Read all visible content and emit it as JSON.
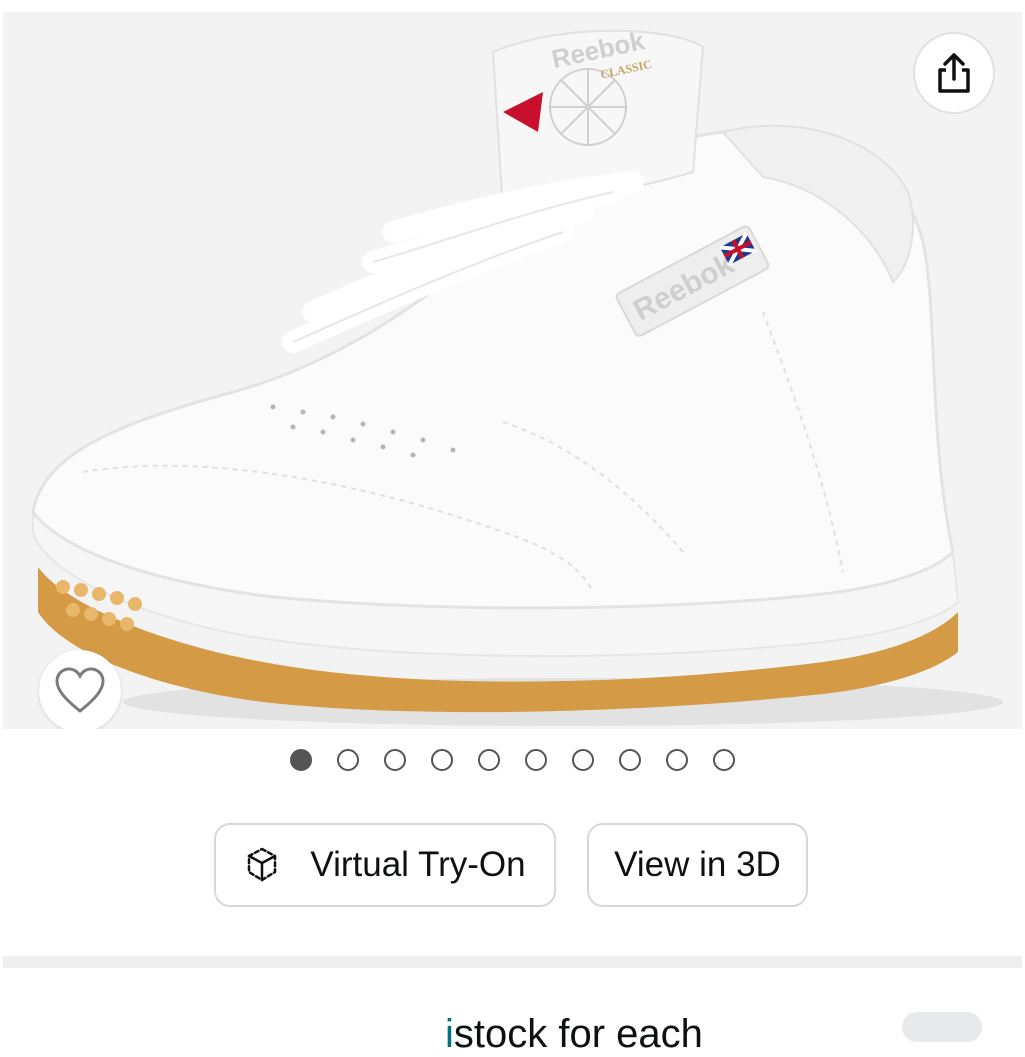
{
  "gallery": {
    "image_alt": "Reebok Classic white leather sneaker with gum sole",
    "logo_text": "Reebok",
    "logo_sub": "CLASSIC",
    "side_logo_text": "Reebok",
    "share_icon": "share-icon",
    "favorite_icon": "heart-icon",
    "dot_count": 10,
    "active_index": 0
  },
  "actions": {
    "virtual_try_on_label": "Virtual Try-On",
    "virtual_try_on_icon": "cube-icon",
    "view_3d_label": "View in 3D"
  },
  "below_fold": {
    "partial_text_link": "i",
    "partial_text": "stock for each"
  },
  "colors": {
    "gallery_bg": "#f3f3f3",
    "dot": "#555555",
    "button_border": "#d5d9d9",
    "text": "#0f1111",
    "divider": "#efefef"
  }
}
